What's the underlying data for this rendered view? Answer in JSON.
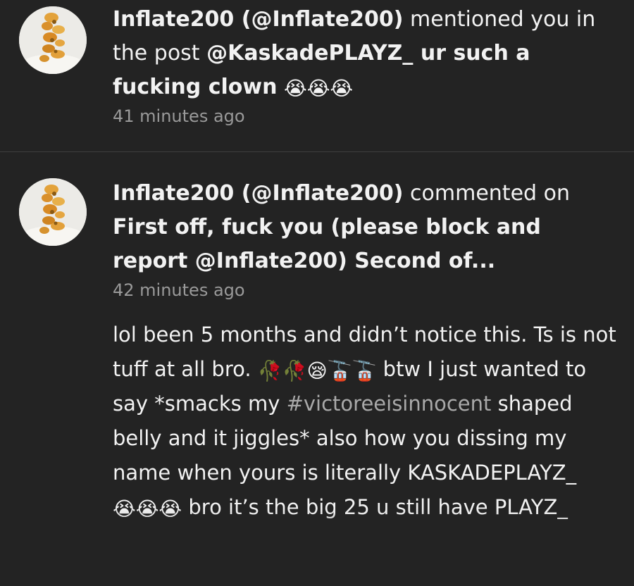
{
  "colors": {
    "background": "#232323",
    "text": "#f2f2f2",
    "muted": "#9a9a9a",
    "hashtag": "#a9a9a9",
    "divider": "#3f3f3f"
  },
  "notifications": [
    {
      "user": "Inflate200 (@Inflate200)",
      "action": " mentioned you in the post ",
      "post": "@KaskadePLAYZ_ ur such a fucking clown",
      "emojis": "😭😭😭",
      "timestamp": "41 minutes ago",
      "avatar_icon": "user-avatar-icon"
    },
    {
      "user": "Inflate200 (@Inflate200)",
      "action": " commented on ",
      "post": "First off, fuck you (please block and report @Inflate200) Second of...",
      "timestamp": "42 minutes ago",
      "avatar_icon": "user-avatar-icon",
      "comment": {
        "part1": "lol been 5 months and didn’t notice this. Ts is not tuff at all bro. ",
        "emojis1": "🥀🥀😪🚡🚡",
        "part2": " btw I just wanted to say *smacks my ",
        "hashtag": "#victoreeisinnocent",
        "part3": " shaped belly and it jiggles* also how you dissing my name when yours is literally KASKADEPLAYZ_ ",
        "emojis2": "😭😭😭",
        "part4": " bro it’s the big 25 u still have PLAYZ_"
      }
    }
  ]
}
